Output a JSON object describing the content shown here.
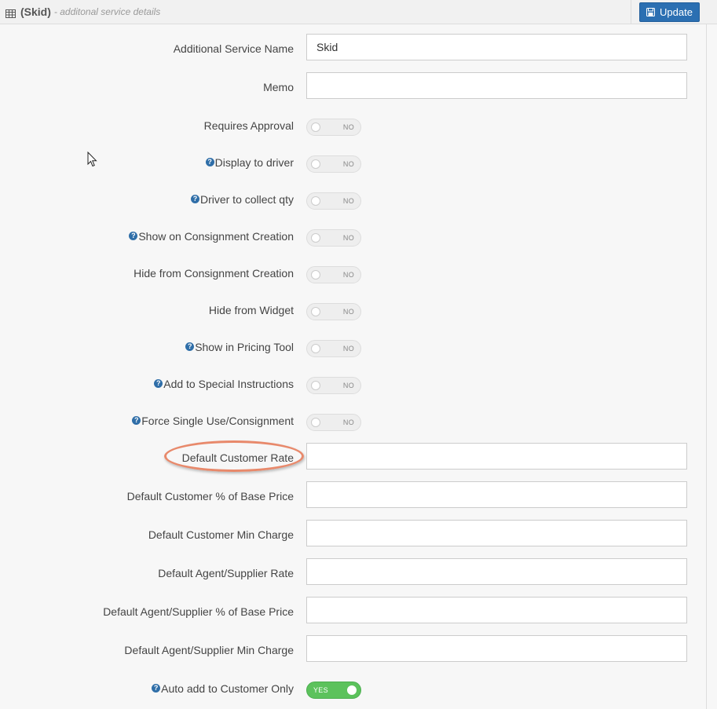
{
  "header": {
    "title": "(Skid)",
    "subtitle": "- additonal service details",
    "update_label": "Update",
    "icons": {
      "table": "table-icon",
      "save": "save-icon"
    },
    "accent": "#2b6fb2"
  },
  "fields": {
    "service_name": {
      "label": "Additional Service Name",
      "value": "Skid"
    },
    "memo": {
      "label": "Memo",
      "value": ""
    },
    "requires_approval": {
      "label": "Requires Approval",
      "state": "NO"
    },
    "display_to_driver": {
      "label": "Display to driver",
      "state": "NO"
    },
    "driver_collect_qty": {
      "label": "Driver to collect qty",
      "state": "NO"
    },
    "show_on_consignment": {
      "label": "Show on Consignment Creation",
      "state": "NO"
    },
    "hide_from_consignment": {
      "label": "Hide from Consignment Creation",
      "state": "NO"
    },
    "hide_from_widget": {
      "label": "Hide from Widget",
      "state": "NO"
    },
    "show_in_pricing": {
      "label": "Show in Pricing Tool",
      "state": "NO"
    },
    "add_special_instructions": {
      "label": "Add to Special Instructions",
      "state": "NO"
    },
    "force_single_use": {
      "label": "Force Single Use/Consignment",
      "state": "NO"
    },
    "default_customer_rate": {
      "label": "Default Customer Rate",
      "value": ""
    },
    "default_customer_pct": {
      "label": "Default Customer % of Base Price",
      "value": ""
    },
    "default_customer_min": {
      "label": "Default Customer Min Charge",
      "value": ""
    },
    "default_agent_rate": {
      "label": "Default Agent/Supplier Rate",
      "value": ""
    },
    "default_agent_pct": {
      "label": "Default Agent/Supplier % of Base Price",
      "value": ""
    },
    "default_agent_min": {
      "label": "Default Agent/Supplier Min Charge",
      "value": ""
    },
    "auto_add_customer": {
      "label": "Auto add to Customer Only",
      "state": "YES"
    }
  },
  "help_icon_glyph": "?",
  "toggle_colors": {
    "on": "#5cc25c",
    "off": "#eeeeee"
  },
  "highlight_color": "#e8896b"
}
